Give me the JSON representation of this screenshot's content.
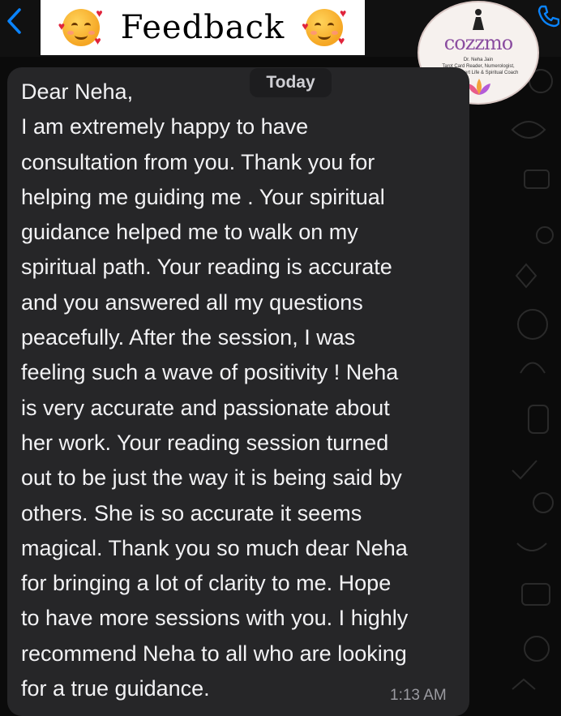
{
  "header": {
    "back_icon": "chevron-left-icon",
    "banner_title": "Feedback",
    "banner_emoji": "smiling-face-with-hearts",
    "call_icon": "phone-icon"
  },
  "logo": {
    "name": "cozzmo",
    "subtitle_lines": [
      "Dr. Neha Jain",
      "Tarot Card Reader, Numerologist,",
      "Dowser Expert Life & Spiritual Coach"
    ]
  },
  "chat": {
    "date_chip": "Today",
    "message_lines": [
      "Dear Neha,",
      "I am extremely happy to have",
      "consultation from you. Thank you for",
      "helping me guiding me . Your spiritual",
      "guidance helped me to walk on my",
      "spiritual path.  Your reading is accurate",
      "and you answered all my questions",
      "peacefully. After the session, I was",
      "feeling such a wave of positivity ! Neha",
      "is very accurate and passionate about",
      "her work. Your reading session turned",
      "out to be just the way it is being said by",
      "others. She is so accurate it seems",
      "magical. Thank you so much dear Neha",
      "for bringing a lot of clarity to me. Hope",
      "to have more sessions with you. I highly",
      "recommend Neha to all who are looking",
      "for a true guidance."
    ],
    "timestamp": "1:13 AM"
  },
  "colors": {
    "background": "#0b0b0b",
    "bubble": "#262628",
    "text": "#f2f2f4",
    "accent": "#0a84ff",
    "logo_text": "#8a4da0"
  }
}
